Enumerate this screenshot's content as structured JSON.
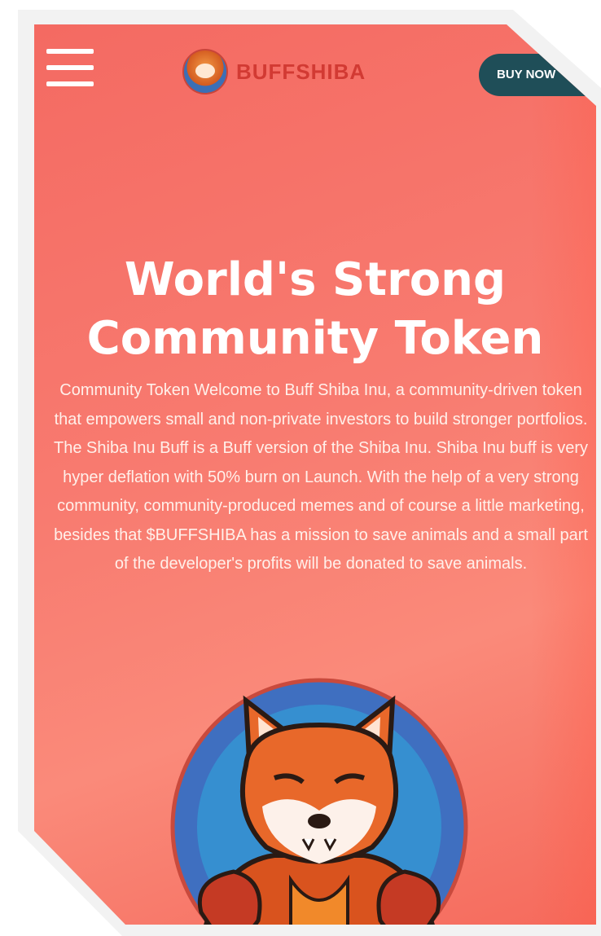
{
  "header": {
    "menu_icon": "hamburger-menu-icon",
    "logo_text": "BUFFSHIBA",
    "buy_button_label": "BUY NOW"
  },
  "hero": {
    "title_line1": "World's Strong",
    "title_line2": "Community Token",
    "description": "Community Token Welcome to Buff Shiba Inu, a community-driven token that empowers small and non-private investors to build stronger portfolios. The Shiba Inu Buff is a Buff version of the Shiba Inu. Shiba Inu buff is very hyper deflation with 50% burn on Launch. With the help of a very strong community, community-produced memes and of course a little marketing, besides that $BUFFSHIBA has a mission to save animals and a small part of the developer's profits will be donated to save animals."
  },
  "colors": {
    "background": "#f87b70",
    "accent_red": "#d23a33",
    "button_dark_teal": "#1f4e58",
    "text_white": "#ffffff"
  }
}
